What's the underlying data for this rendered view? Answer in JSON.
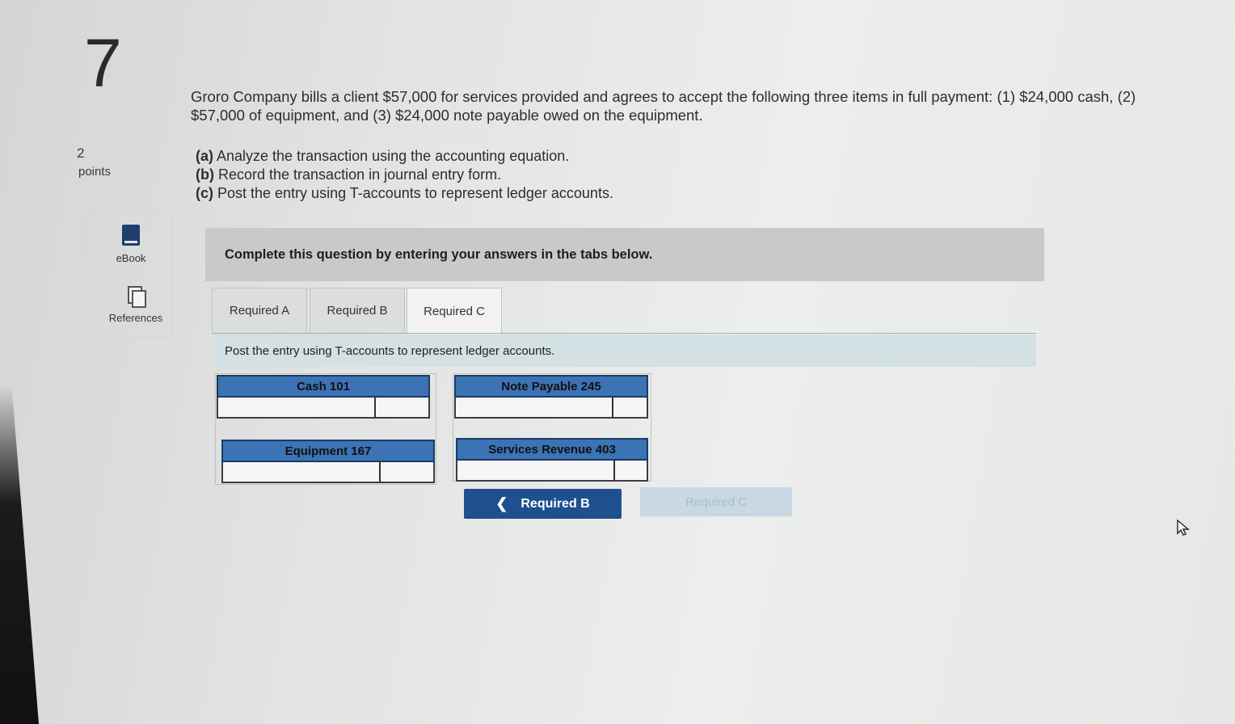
{
  "question": {
    "number": "7",
    "points_value": "2",
    "points_label": "points",
    "text": "Groro Company bills a client $57,000 for services provided and agrees to accept the following three items in full payment: (1) $24,000 cash, (2) $57,000 of equipment, and (3) $24,000 note payable owed on the equipment.",
    "parts": [
      {
        "tag": "(a)",
        "text": " Analyze the transaction using the accounting equation."
      },
      {
        "tag": "(b)",
        "text": " Record the transaction in journal entry form."
      },
      {
        "tag": "(c)",
        "text": " Post the entry using T-accounts to represent ledger accounts."
      }
    ]
  },
  "sidebar": {
    "ebook_label": "eBook",
    "references_label": "References"
  },
  "banner": "Complete this question by entering your answers in the tabs below.",
  "tabs": [
    {
      "label": "Required A",
      "active": false
    },
    {
      "label": "Required B",
      "active": false
    },
    {
      "label": "Required C",
      "active": true
    }
  ],
  "instruction": "Post the entry using T-accounts to represent ledger accounts.",
  "t_accounts": [
    {
      "title": "Cash 101"
    },
    {
      "title": "Note Payable 245"
    },
    {
      "title": "Equipment 167"
    },
    {
      "title": "Services Revenue 403"
    }
  ],
  "nav": {
    "prev_label": "Required B",
    "next_label": "Required C"
  },
  "colors": {
    "header_blue": "#3b73b4",
    "button_blue": "#1e4f8e",
    "banner_gray": "#c8cac9",
    "instruction_bg": "#d3e0e4"
  }
}
